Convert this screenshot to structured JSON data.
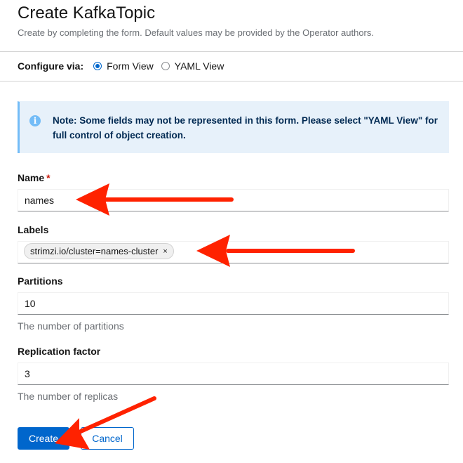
{
  "header": {
    "title": "Create KafkaTopic",
    "subtitle": "Create by completing the form. Default values may be provided by the Operator authors."
  },
  "configure": {
    "label": "Configure via:",
    "options": [
      {
        "label": "Form View",
        "selected": true
      },
      {
        "label": "YAML View",
        "selected": false
      }
    ]
  },
  "alert": {
    "icon": "info-icon",
    "text": "Note: Some fields may not be represented in this form. Please select \"YAML View\" for full control of object creation."
  },
  "form": {
    "name": {
      "label": "Name",
      "required_mark": "*",
      "value": "names"
    },
    "labels": {
      "label": "Labels",
      "chips": [
        {
          "text": "strimzi.io/cluster=names-cluster",
          "close": "×"
        }
      ]
    },
    "partitions": {
      "label": "Partitions",
      "value": "10",
      "helper": "The number of partitions"
    },
    "replication": {
      "label": "Replication factor",
      "value": "3",
      "helper": "The number of replicas"
    }
  },
  "actions": {
    "create_label": "Create",
    "cancel_label": "Cancel"
  },
  "colors": {
    "primary": "#0066cc",
    "alert_bg": "#e7f1fa",
    "alert_border": "#73bcf7",
    "annotation_arrow": "#ff2200"
  }
}
